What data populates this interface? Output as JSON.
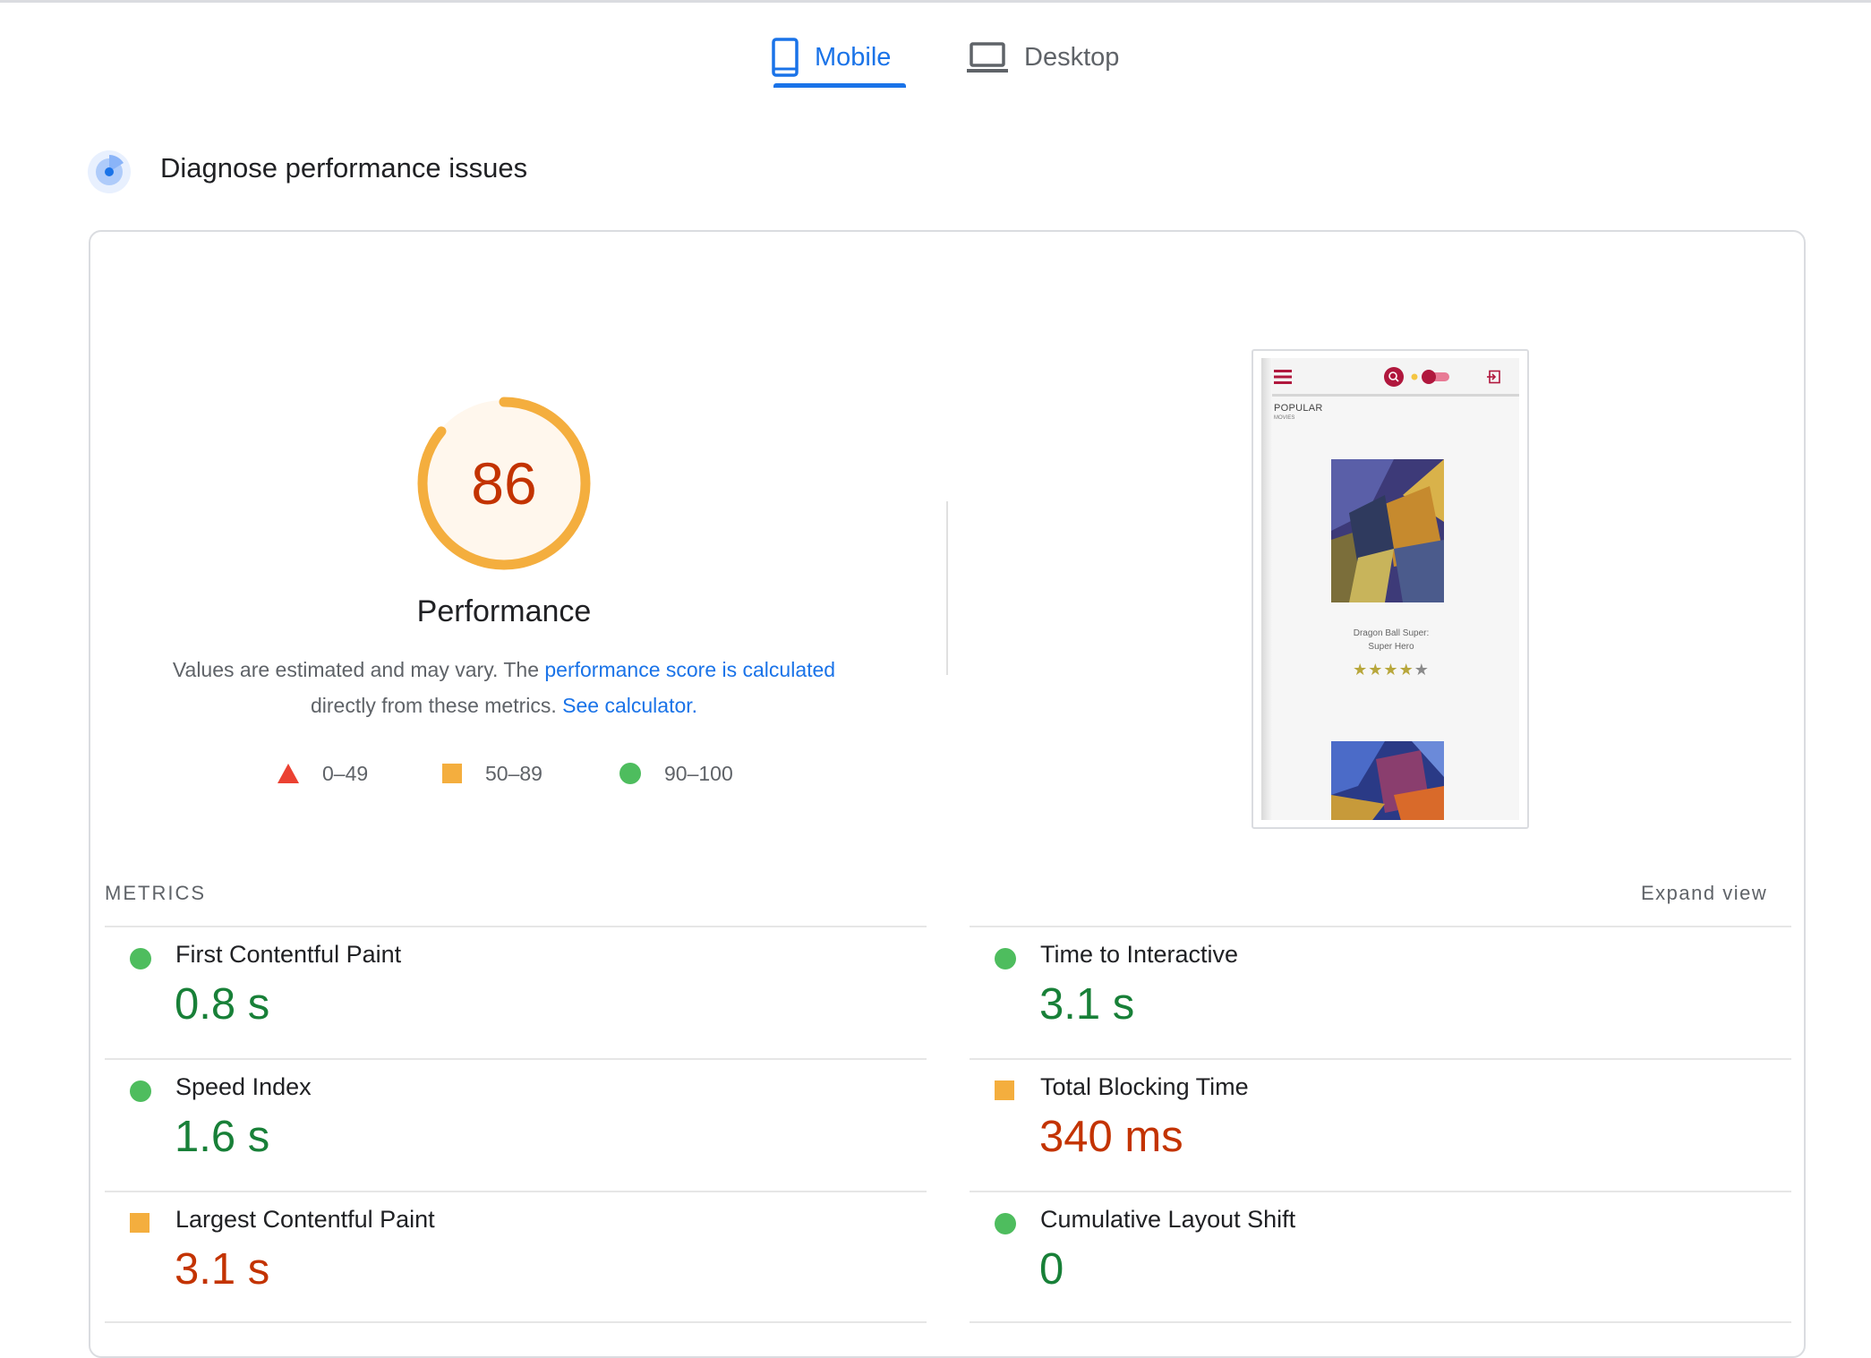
{
  "tabs": {
    "mobile_label": "Mobile",
    "desktop_label": "Desktop",
    "active": "Mobile"
  },
  "section": {
    "title": "Diagnose performance issues"
  },
  "performance": {
    "score": "86",
    "score_fraction": 0.86,
    "title": "Performance",
    "desc_prefix": "Values are estimated and may vary. The ",
    "desc_link1": "performance score is calculated",
    "desc_middle": " directly from these metrics. ",
    "desc_link2": "See calculator.",
    "gauge_color": "#f4ae3e",
    "gauge_fill_color": "#fff7ed",
    "score_color": "#c33300"
  },
  "legend": {
    "fail": "0–49",
    "average": "50–89",
    "pass": "90–100",
    "fail_color": "#eb4132",
    "average_color": "#f4ae3e",
    "pass_color": "#4ebd5e"
  },
  "screenshot": {
    "heading": "POPULAR",
    "subheading": "MOVIES",
    "movie_title_line1": "Dragon Ball Super:",
    "movie_title_line2": "Super Hero",
    "rating_stars": 4,
    "rating_max": 5,
    "accent_color": "#b0173d"
  },
  "metrics": {
    "label": "METRICS",
    "expand_label": "Expand view",
    "fcp": {
      "title": "First Contentful Paint",
      "value": "0.8 s",
      "status": "pass"
    },
    "si": {
      "title": "Speed Index",
      "value": "1.6 s",
      "status": "pass"
    },
    "lcp": {
      "title": "Largest Contentful Paint",
      "value": "3.1 s",
      "status": "average"
    },
    "tti": {
      "title": "Time to Interactive",
      "value": "3.1 s",
      "status": "pass"
    },
    "tbt": {
      "title": "Total Blocking Time",
      "value": "340 ms",
      "status": "average"
    },
    "cls": {
      "title": "Cumulative Layout Shift",
      "value": "0",
      "status": "pass"
    }
  },
  "colors": {
    "link": "#1a73e8",
    "pass_text": "#188038",
    "average_text": "#c33300"
  }
}
